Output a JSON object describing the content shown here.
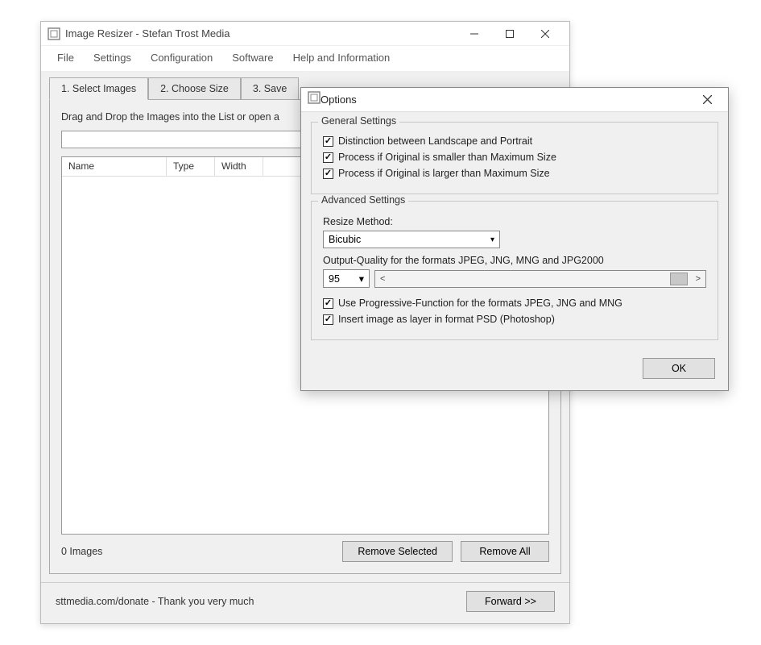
{
  "main": {
    "title": "Image Resizer - Stefan Trost Media",
    "menus": [
      "File",
      "Settings",
      "Configuration",
      "Software",
      "Help and Information"
    ],
    "tabs": [
      "1. Select Images",
      "2. Choose Size",
      "3. Save"
    ],
    "instruction": "Drag and Drop the Images into the List or open a",
    "columns": {
      "name": "Name",
      "type": "Type",
      "width": "Width"
    },
    "status": "0 Images",
    "removeSelected": "Remove Selected",
    "removeAll": "Remove All",
    "donate": "sttmedia.com/donate - Thank you very much",
    "forward": "Forward >>"
  },
  "options": {
    "title": "Options",
    "general": {
      "legend": "General Settings",
      "distinction": "Distinction between Landscape and Portrait",
      "smaller": "Process if Original is smaller than Maximum Size",
      "larger": "Process if Original is larger than Maximum Size"
    },
    "advanced": {
      "legend": "Advanced Settings",
      "resizeMethodLabel": "Resize Method:",
      "resizeMethod": "Bicubic",
      "qualityLabel": "Output-Quality for the formats JPEG, JNG, MNG and JPG2000",
      "quality": "95",
      "progressive": "Use Progressive-Function for the formats JPEG, JNG and MNG",
      "psd": "Insert image as layer in format PSD (Photoshop)"
    },
    "ok": "OK"
  }
}
